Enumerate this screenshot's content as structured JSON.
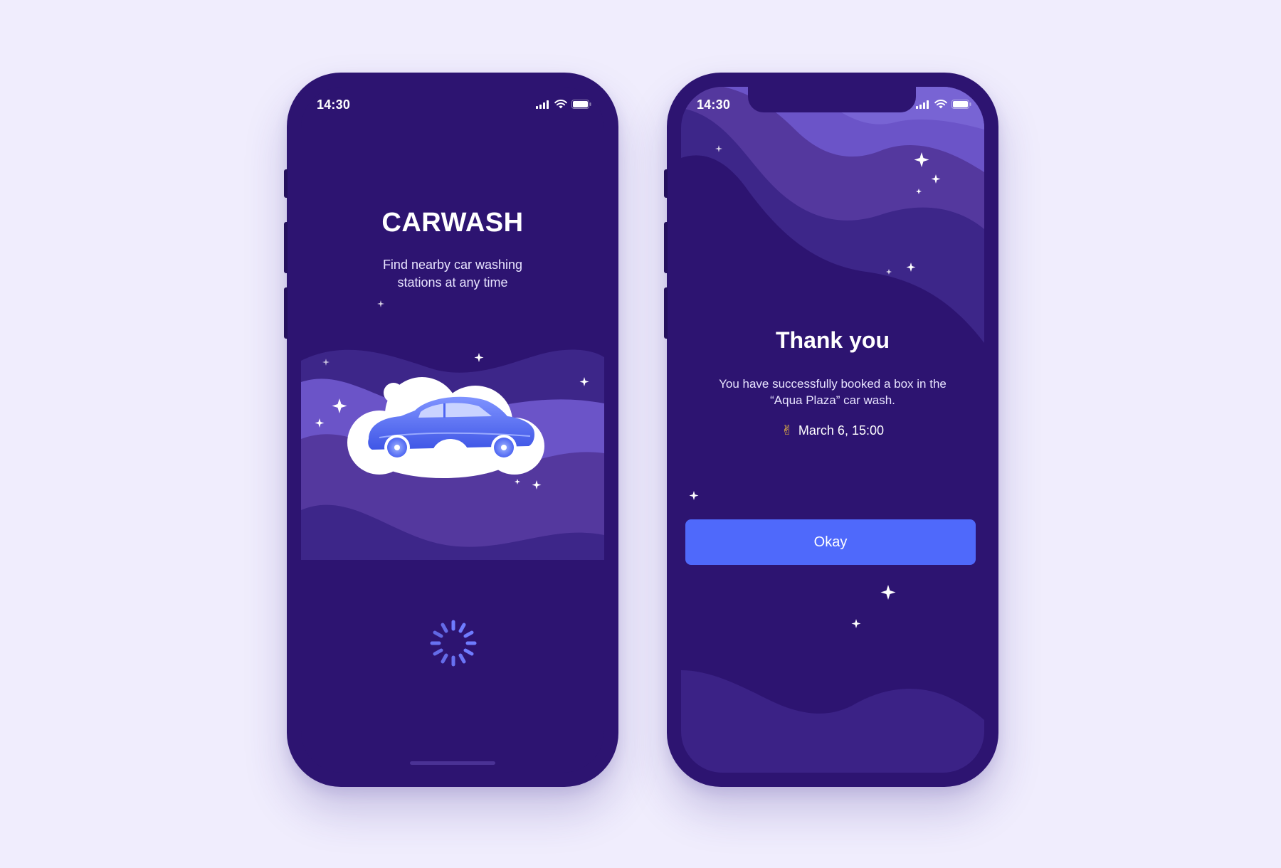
{
  "splash_screen": {
    "status_time": "14:30",
    "title": "CARWASH",
    "subtitle": "Find nearby car washing stations at any time",
    "loading_indicator": "spinner"
  },
  "thank_you_screen": {
    "status_time": "14:30",
    "title": "Thank you",
    "message": "You have successfully booked a box in the “Aqua Plaza” car wash.",
    "booking_emoji": "✌",
    "booking_datetime": "March 6, 15:00",
    "okay_button_label": "Okay"
  },
  "colors": {
    "page_background": "#f0edfd",
    "screen_background": "#2d1471",
    "wave_light": "#6b54c8",
    "wave_mid": "#54389e",
    "wave_dark": "#3d2689",
    "accent_blue": "#4f69fb",
    "car_blue": "#4d65f2",
    "emoji_yellow": "#f4c13d"
  },
  "icons": {
    "status_bar": [
      "signal-icon",
      "wifi-icon",
      "battery-icon"
    ],
    "illustration": "car-in-cloud-illustration",
    "decorations": "sparkle-icon"
  }
}
